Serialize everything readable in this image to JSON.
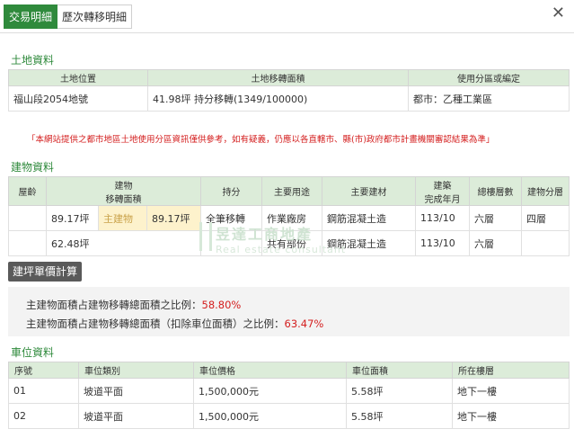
{
  "tabs": [
    "交易明細",
    "歷次轉移明細"
  ],
  "close_icon": "close-icon",
  "land": {
    "title": "土地資料",
    "headers": [
      "土地位置",
      "土地移轉面積",
      "使用分區或編定"
    ],
    "row": {
      "location": "福山段2054地號",
      "area": "41.98坪 持分移轉(1349/100000)",
      "zoning": "都市：乙種工業區"
    }
  },
  "notice": "「本網站提供之都市地區土地使用分區資訊僅供參考，如有疑義，仍應以各直轄市、縣(市)政府都市計畫機關審認結果為準」",
  "building": {
    "title": "建物資料",
    "headers": {
      "age": "屋齡",
      "transfer_area_1": "建物",
      "transfer_area_2": "移轉面積",
      "share": "持分",
      "usage": "主要用途",
      "material": "主要建材",
      "completed_1": "建築",
      "completed_2": "完成年月",
      "floors": "總樓層數",
      "level": "建物分層"
    },
    "rows": [
      {
        "age": "",
        "total": "89.17坪",
        "main_label": "主建物",
        "main_area": "89.17坪",
        "share": "全筆移轉",
        "usage": "作業廠房",
        "material": "鋼筋混凝土造",
        "completed": "113/10",
        "floors": "六層",
        "level": "四層"
      },
      {
        "age": "",
        "total": "62.48坪",
        "main_label": "",
        "main_area": "",
        "share": "",
        "usage": "共有部份",
        "material": "鋼筋混凝土造",
        "completed": "113/10",
        "floors": "六層",
        "level": ""
      }
    ]
  },
  "calc_button": "建坪單價計算",
  "ratios": [
    {
      "label": "主建物面積占建物移轉總面積之比例：",
      "value": "58.80%"
    },
    {
      "label": "主建物面積占建物移轉總面積（扣除車位面積）之比例：",
      "value": "63.47%"
    }
  ],
  "watermark": {
    "name": "昱達工商地產",
    "sub": "Real estate consultant"
  },
  "parking": {
    "title": "車位資料",
    "headers": [
      "序號",
      "車位類別",
      "車位價格",
      "車位面積",
      "所在樓層"
    ],
    "rows": [
      {
        "no": "01",
        "type": "坡道平面",
        "price": "1,500,000元",
        "area": "5.58坪",
        "floor": "地下一樓"
      },
      {
        "no": "02",
        "type": "坡道平面",
        "price": "1,500,000元",
        "area": "5.58坪",
        "floor": "地下一樓"
      }
    ]
  },
  "colors": {
    "accent": "#2f8a3c",
    "header_bg": "#dcecd9",
    "warning": "#d42020",
    "highlight": "#fdf2cc"
  }
}
